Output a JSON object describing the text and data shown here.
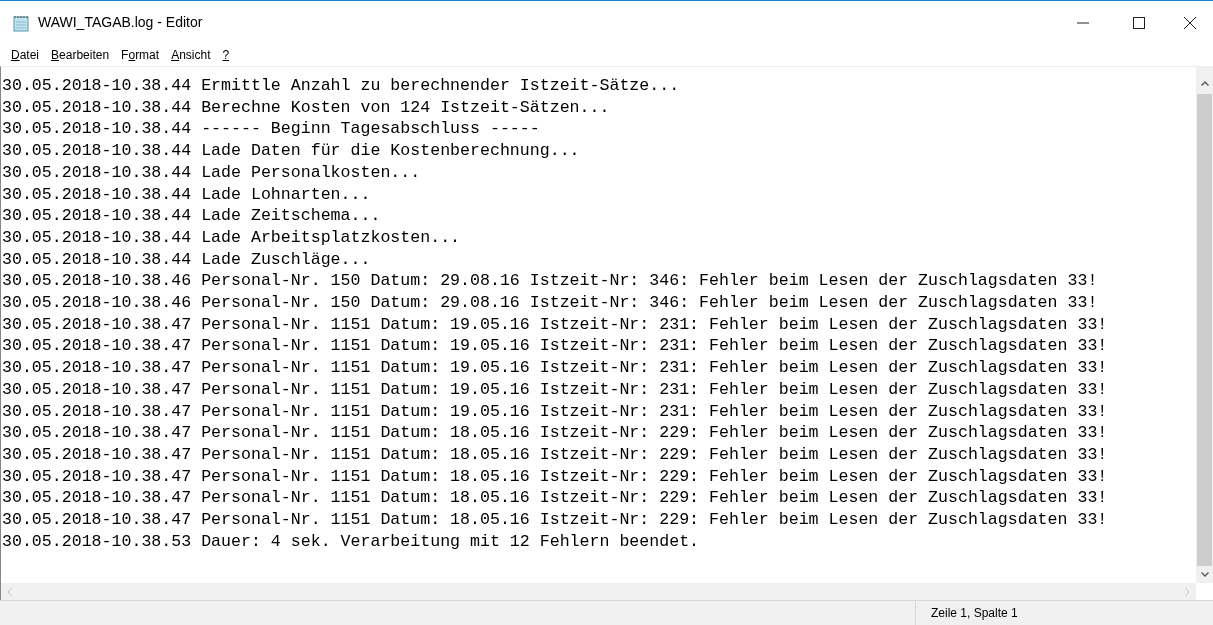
{
  "window": {
    "title": "WAWI_TAGAB.log - Editor"
  },
  "menu": [
    {
      "mnemonic": "D",
      "after": "atei"
    },
    {
      "mnemonic": "B",
      "after": "earbeiten"
    },
    {
      "before": "F",
      "mnemonic": "o",
      "after": "rmat"
    },
    {
      "mnemonic": "A",
      "after": "nsicht"
    },
    {
      "mnemonic": "?"
    }
  ],
  "lines": [
    "30.05.2018-10.38.44 Ermittle Anzahl zu berechnender Istzeit-Sätze...",
    "30.05.2018-10.38.44 Berechne Kosten von 124 Istzeit-Sätzen...",
    "30.05.2018-10.38.44 ------ Beginn Tagesabschluss -----",
    "30.05.2018-10.38.44 Lade Daten für die Kostenberechnung...",
    "30.05.2018-10.38.44 Lade Personalkosten...",
    "30.05.2018-10.38.44 Lade Lohnarten...",
    "30.05.2018-10.38.44 Lade Zeitschema...",
    "30.05.2018-10.38.44 Lade Arbeitsplatzkosten...",
    "30.05.2018-10.38.44 Lade Zuschläge...",
    "30.05.2018-10.38.46 Personal-Nr. 150 Datum: 29.08.16 Istzeit-Nr: 346: Fehler beim Lesen der Zuschlagsdaten 33!",
    "30.05.2018-10.38.46 Personal-Nr. 150 Datum: 29.08.16 Istzeit-Nr: 346: Fehler beim Lesen der Zuschlagsdaten 33!",
    "30.05.2018-10.38.47 Personal-Nr. 1151 Datum: 19.05.16 Istzeit-Nr: 231: Fehler beim Lesen der Zuschlagsdaten 33!",
    "30.05.2018-10.38.47 Personal-Nr. 1151 Datum: 19.05.16 Istzeit-Nr: 231: Fehler beim Lesen der Zuschlagsdaten 33!",
    "30.05.2018-10.38.47 Personal-Nr. 1151 Datum: 19.05.16 Istzeit-Nr: 231: Fehler beim Lesen der Zuschlagsdaten 33!",
    "30.05.2018-10.38.47 Personal-Nr. 1151 Datum: 19.05.16 Istzeit-Nr: 231: Fehler beim Lesen der Zuschlagsdaten 33!",
    "30.05.2018-10.38.47 Personal-Nr. 1151 Datum: 19.05.16 Istzeit-Nr: 231: Fehler beim Lesen der Zuschlagsdaten 33!",
    "30.05.2018-10.38.47 Personal-Nr. 1151 Datum: 18.05.16 Istzeit-Nr: 229: Fehler beim Lesen der Zuschlagsdaten 33!",
    "30.05.2018-10.38.47 Personal-Nr. 1151 Datum: 18.05.16 Istzeit-Nr: 229: Fehler beim Lesen der Zuschlagsdaten 33!",
    "30.05.2018-10.38.47 Personal-Nr. 1151 Datum: 18.05.16 Istzeit-Nr: 229: Fehler beim Lesen der Zuschlagsdaten 33!",
    "30.05.2018-10.38.47 Personal-Nr. 1151 Datum: 18.05.16 Istzeit-Nr: 229: Fehler beim Lesen der Zuschlagsdaten 33!",
    "30.05.2018-10.38.47 Personal-Nr. 1151 Datum: 18.05.16 Istzeit-Nr: 229: Fehler beim Lesen der Zuschlagsdaten 33!",
    "30.05.2018-10.38.53 Dauer: 4 sek. Verarbeitung mit 12 Fehlern beendet."
  ],
  "status_bar": {
    "position": "Zeile 1, Spalte 1"
  }
}
